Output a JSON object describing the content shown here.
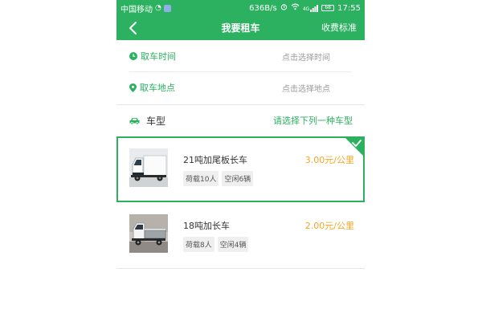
{
  "status_bar": {
    "carrier": "中国移动",
    "speed": "636B/s",
    "network": "4G",
    "battery": "68",
    "time": "17:55"
  },
  "nav": {
    "title": "我要租车",
    "action": "收费标准",
    "back_icon": "chevron-left-icon"
  },
  "form": {
    "pickup_time": {
      "label": "取车时间",
      "placeholder": "点击选择时间",
      "icon": "clock-icon"
    },
    "pickup_location": {
      "label": "取车地点",
      "placeholder": "点击选择地点",
      "icon": "location-pin-icon"
    },
    "car_type": {
      "label": "车型",
      "hint": "请选择下列一种车型",
      "icon": "car-icon"
    }
  },
  "vehicles": [
    {
      "name": "21吨加尾板长车",
      "price": "3.00元/公里",
      "load": "荷载10人",
      "available": "空闲6辆",
      "selected": true
    },
    {
      "name": "18吨加长车",
      "price": "2.00元/公里",
      "load": "荷载8人",
      "available": "空闲4辆",
      "selected": false
    }
  ],
  "colors": {
    "brand_green": "#2bb160",
    "price_orange": "#f5a623"
  }
}
